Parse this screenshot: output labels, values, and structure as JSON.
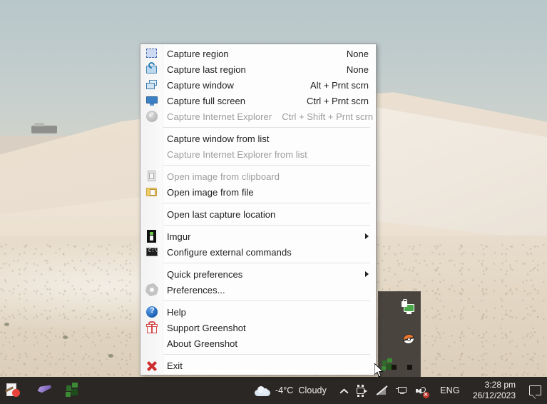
{
  "app": {
    "name": "Greenshot",
    "menu_title": "Greenshot context menu"
  },
  "menu": {
    "groups": [
      {
        "items": [
          {
            "label": "Capture region",
            "accel": "None",
            "icon": "capture-region-icon",
            "disabled": false,
            "submenu": false
          },
          {
            "label": "Capture last region",
            "accel": "None",
            "icon": "capture-last-region-icon",
            "disabled": false,
            "submenu": false
          },
          {
            "label": "Capture window",
            "accel": "Alt + Prnt scrn",
            "icon": "capture-window-icon",
            "disabled": false,
            "submenu": false
          },
          {
            "label": "Capture full screen",
            "accel": "Ctrl + Prnt scrn",
            "icon": "capture-fullscreen-icon",
            "disabled": false,
            "submenu": false
          },
          {
            "label": "Capture Internet Explorer",
            "accel": "Ctrl + Shift + Prnt scrn",
            "icon": "internet-explorer-icon",
            "disabled": true,
            "submenu": false
          }
        ]
      },
      {
        "items": [
          {
            "label": "Capture window from list",
            "accel": "",
            "icon": "",
            "disabled": false,
            "submenu": false
          },
          {
            "label": "Capture Internet Explorer from list",
            "accel": "",
            "icon": "",
            "disabled": true,
            "submenu": false
          }
        ]
      },
      {
        "items": [
          {
            "label": "Open image from clipboard",
            "accel": "",
            "icon": "clipboard-icon",
            "disabled": true,
            "submenu": false
          },
          {
            "label": "Open image from file",
            "accel": "",
            "icon": "folder-image-icon",
            "disabled": false,
            "submenu": false
          }
        ]
      },
      {
        "items": [
          {
            "label": "Open last capture location",
            "accel": "",
            "icon": "",
            "disabled": false,
            "submenu": false
          }
        ]
      },
      {
        "items": [
          {
            "label": "Imgur",
            "accel": "",
            "icon": "imgur-icon",
            "disabled": false,
            "submenu": true
          },
          {
            "label": "Configure external commands",
            "accel": "",
            "icon": "console-icon",
            "disabled": false,
            "submenu": false
          }
        ]
      },
      {
        "items": [
          {
            "label": "Quick preferences",
            "accel": "",
            "icon": "",
            "disabled": false,
            "submenu": true
          },
          {
            "label": "Preferences...",
            "accel": "",
            "icon": "gear-icon",
            "disabled": false,
            "submenu": false
          }
        ]
      },
      {
        "items": [
          {
            "label": "Help",
            "accel": "",
            "icon": "help-icon",
            "disabled": false,
            "submenu": false
          },
          {
            "label": "Support Greenshot",
            "accel": "",
            "icon": "gift-icon",
            "disabled": false,
            "submenu": false
          },
          {
            "label": "About Greenshot",
            "accel": "",
            "icon": "",
            "disabled": false,
            "submenu": false
          }
        ]
      },
      {
        "items": [
          {
            "label": "Exit",
            "accel": "",
            "icon": "exit-icon",
            "disabled": false,
            "submenu": false
          }
        ]
      }
    ]
  },
  "tray_popup": {
    "icons": [
      {
        "name": "secure-connection-icon"
      },
      {
        "name": "pokeball-icon"
      },
      {
        "name": "greenshot-tray-icon"
      }
    ]
  },
  "taskbar": {
    "apps": [
      {
        "name": "paint-app-icon"
      },
      {
        "name": "ink-workspace-icon"
      },
      {
        "name": "greenshot-app-icon"
      }
    ],
    "weather": {
      "icon": "cloud-icon",
      "temperature": "-4°C",
      "condition": "Cloudy"
    },
    "tray": {
      "show_hidden_icons": "show-hidden-icons-chevron",
      "icons": [
        {
          "name": "camera-capture-icon"
        },
        {
          "name": "no-network-icon"
        },
        {
          "name": "network-monitor-icon"
        },
        {
          "name": "volume-muted-icon"
        }
      ]
    },
    "language": "ENG",
    "clock": {
      "time": "3:28 pm",
      "date": "26/12/2023"
    },
    "action_center": "action-center-icon"
  },
  "colors": {
    "taskbar_bg": "#2b2724",
    "menu_bg": "#fdfdfd",
    "menu_border": "#9a9a9a",
    "menu_gutter": "#f4f4f4",
    "disabled_text": "#9d9d9d",
    "text": "#1c1c1c",
    "accent_blue": "#3b7fc4",
    "tray_popup_bg": "#3e3935"
  }
}
